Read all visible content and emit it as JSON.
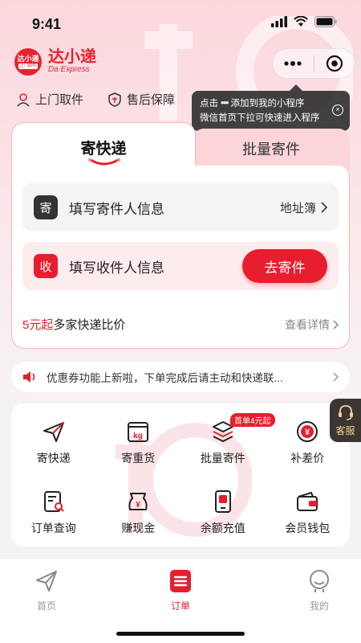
{
  "status_bar": {
    "time": "9:41"
  },
  "brand": {
    "logo_line1": "达小递",
    "logo_line2": "上门取件",
    "name": "达小递",
    "sub": "Da Express"
  },
  "quick_links": [
    {
      "label": "上门取件",
      "icon": "user-icon"
    },
    {
      "label": "售后保障",
      "icon": "shield-icon"
    }
  ],
  "tooltip": {
    "line1_prefix": "点击",
    "line1_dots": "•••",
    "line1_suffix": "添加到我的小程序",
    "line2": "微信首页下拉可快速进入程序",
    "close": "×"
  },
  "tabs": {
    "active": "寄快递",
    "inactive": "批量寄件"
  },
  "sender": {
    "badge": "寄",
    "label": "填写寄件人信息",
    "address_book": "地址簿"
  },
  "receiver": {
    "badge": "收",
    "label": "填写收件人信息",
    "button": "去寄件"
  },
  "compare": {
    "price": "5元起",
    "text": "多家快递比价",
    "detail": "查看详情"
  },
  "notice": {
    "text": "优惠券功能上新啦，下单完成后请主动和快递联..."
  },
  "service": {
    "label": "客服"
  },
  "grid": [
    {
      "label": "寄快递",
      "icon": "paper-plane-icon"
    },
    {
      "label": "寄重货",
      "icon": "kg-box-icon",
      "mark": "kg"
    },
    {
      "label": "批量寄件",
      "icon": "stack-icon",
      "badge": "首单4元起"
    },
    {
      "label": "补差价",
      "icon": "yuan-circle-icon",
      "mark": "¥"
    },
    {
      "label": "订单查询",
      "icon": "order-search-icon"
    },
    {
      "label": "赚现金",
      "icon": "cash-bag-icon",
      "mark": "¥"
    },
    {
      "label": "余额充值",
      "icon": "phone-recharge-icon"
    },
    {
      "label": "会员钱包",
      "icon": "wallet-icon"
    }
  ],
  "nav": [
    {
      "label": "首页",
      "icon": "paper-plane-icon"
    },
    {
      "label": "订单",
      "icon": "order-list-icon",
      "active": true
    },
    {
      "label": "我的",
      "icon": "profile-icon"
    }
  ],
  "colors": {
    "accent": "#e81d2d",
    "tab_inactive_bg": "#fbd5da",
    "receiver_bg": "#fdecee"
  }
}
